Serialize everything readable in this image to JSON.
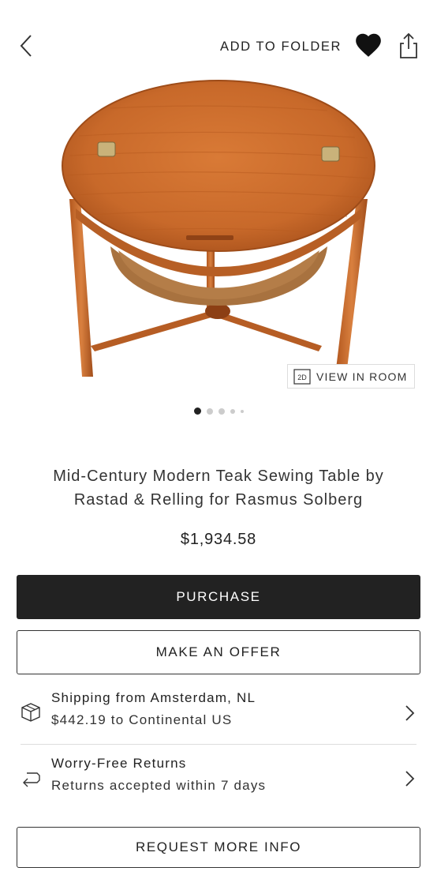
{
  "header": {
    "back_icon": "chevron-left-icon",
    "add_to_folder_label": "ADD TO FOLDER",
    "heart_icon": "heart-icon",
    "share_icon": "share-icon"
  },
  "image": {
    "view_in_room_badge": "2D",
    "view_in_room_label": "VIEW IN ROOM",
    "carousel_dot_count": 5,
    "carousel_active_index": 0
  },
  "product": {
    "title_line1": "Mid-Century Modern Teak Sewing Table by",
    "title_line2": "Rastad & Relling for Rasmus Solberg",
    "price": "$1,934.58"
  },
  "actions": {
    "purchase_label": "PURCHASE",
    "offer_label": "MAKE AN OFFER",
    "request_info_label": "REQUEST MORE INFO"
  },
  "shipping": {
    "icon": "package-icon",
    "title": "Shipping from Amsterdam, NL",
    "subtitle": "$442.19 to Continental US"
  },
  "returns": {
    "icon": "return-arrow-icon",
    "title": "Worry-Free Returns",
    "subtitle": "Returns accepted within 7 days"
  },
  "colors": {
    "primary_button": "#222222",
    "teak": "#c8692a"
  }
}
